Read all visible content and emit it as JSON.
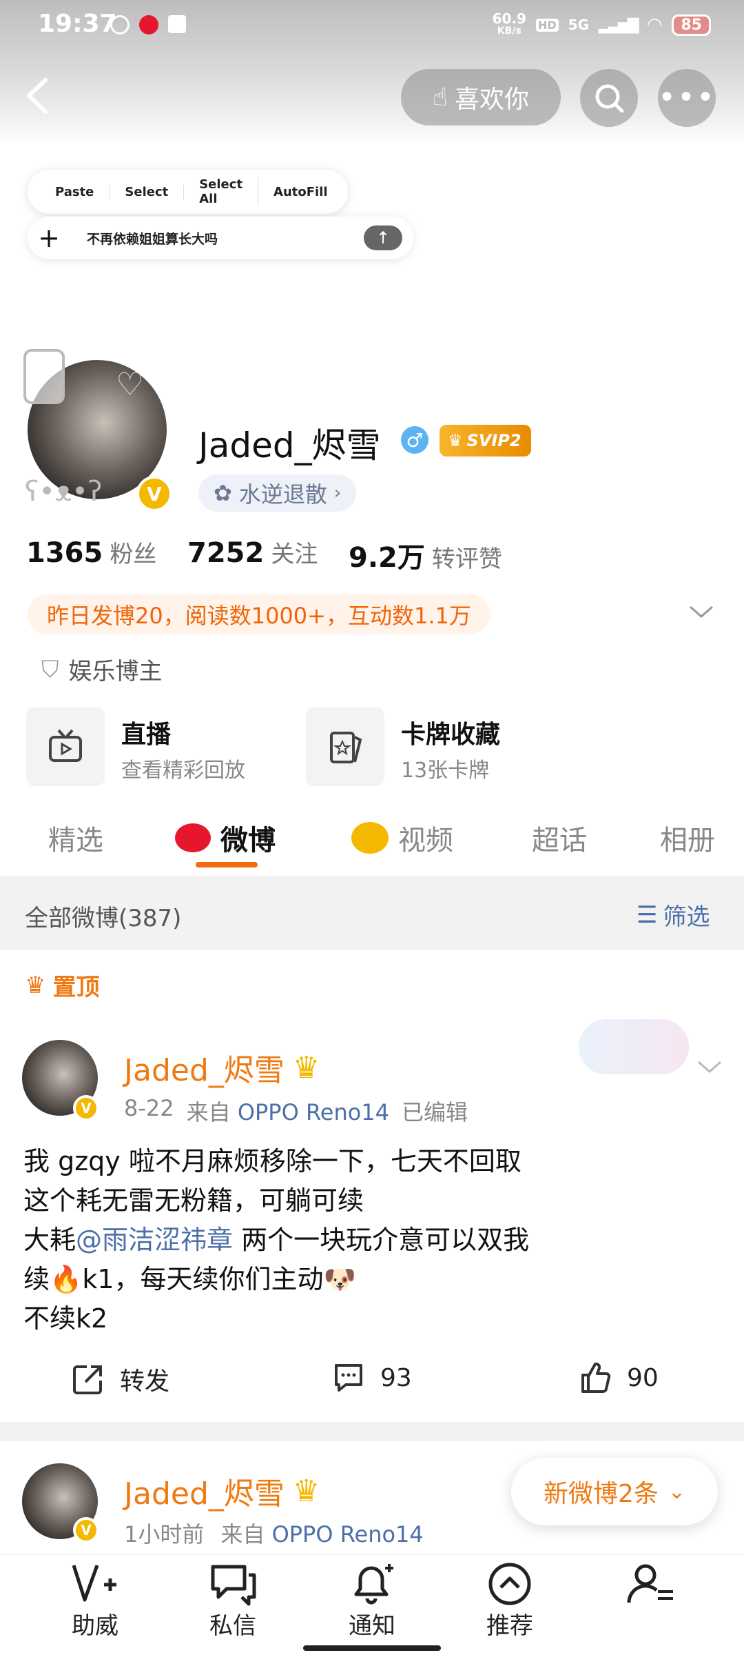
{
  "status_bar": {
    "time": "19:37",
    "network_speed": "60.9",
    "network_unit": "KB/s",
    "hd": "HD",
    "signal": "5G",
    "battery": "85"
  },
  "top_bar": {
    "like_label": "喜欢你"
  },
  "text_toolbar": {
    "paste": "Paste",
    "select": "Select",
    "select_all": "Select All",
    "autofill": "AutoFill"
  },
  "input": {
    "value": "不再依赖姐姐算长大吗"
  },
  "profile": {
    "name": "Jaded_烬雪",
    "gender_icon": "♂",
    "vip": "SVIP2",
    "tag": "水逆退散",
    "stats": [
      {
        "num": "1365",
        "label": "粉丝"
      },
      {
        "num": "7252",
        "label": "关注"
      },
      {
        "num": "9.2万",
        "label": "转评赞"
      }
    ],
    "summary": "昨日发博20，阅读数1000+，互动数1.1万",
    "category": "娱乐博主"
  },
  "cards": [
    {
      "title": "直播",
      "subtitle": "查看精彩回放"
    },
    {
      "title": "卡牌收藏",
      "subtitle": "13张卡牌"
    }
  ],
  "tabs": [
    "精选",
    "微博",
    "视频",
    "超话",
    "相册"
  ],
  "section": {
    "title": "全部微博(387)",
    "filter": "筛选"
  },
  "pinned_label": "置顶",
  "post1": {
    "author": "Jaded_烬雪",
    "date": "8-22",
    "from": "来自",
    "device": "OPPO Reno14",
    "edited": "已编辑",
    "line1": "我 gzqy 啦不月麻烦移除一下，七天不回取",
    "line2": "这个耗无雷无粉籍，可躺可续",
    "line3_pre": "大耗",
    "line3_mention": "@雨洁涩祎章",
    "line3_post": " 两个一块玩介意可以双我",
    "line4_pre": "续",
    "line4_emoji": "🔥",
    "line4_post": "k1，每天续你们主动",
    "line4_emoji2": "🐶",
    "line5": "不续k2",
    "repost_label": "转发",
    "comments": "93",
    "likes": "90"
  },
  "post2": {
    "author": "Jaded_烬雪",
    "time": "1小时前",
    "from": "来自",
    "device": "OPPO Reno14"
  },
  "new_posts_toast": "新微博2条",
  "bottom_nav": [
    "助威",
    "私信",
    "通知",
    "推荐",
    ""
  ]
}
